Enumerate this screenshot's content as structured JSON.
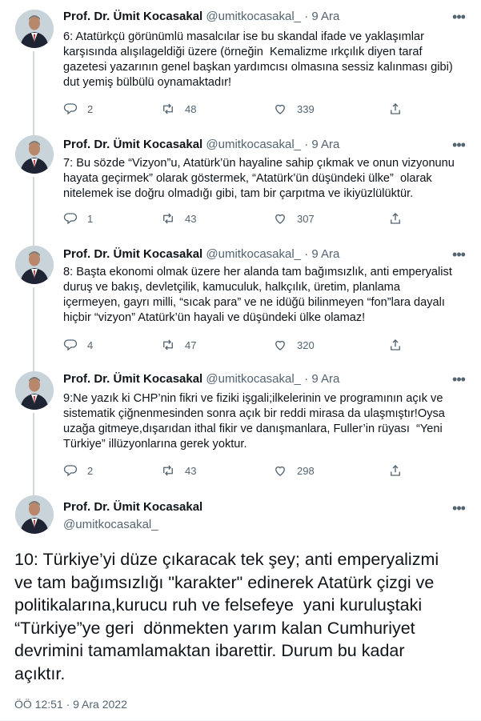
{
  "author": {
    "name": "Prof. Dr. Ümit Kocasakal",
    "handle": "@umitkocasakal_"
  },
  "separator": "·",
  "tweets": [
    {
      "time": "9 Ara",
      "lines": [
        "6: Atatürkçü görünümlü masalcılar ise bu skandal ifade ve yaklaşımlar",
        "karşısında alışılageldiği üzere (örneğin  Kemalizme ırkçılık diyen taraf",
        "gazetesi yazarının genel başkan yardımcısı olmasına sessiz kalınması gibi)",
        "dut yemiş bülbülü oynamaktadır!"
      ],
      "replies": "2",
      "retweets": "48",
      "likes": "339"
    },
    {
      "time": "9 Ara",
      "lines": [
        "7: Bu sözde “Vizyon”u, Atatürk’ün hayaline sahip çıkmak ve onun vizyonunu",
        "hayata geçirmek” olarak göstermek, “Atatürk’ün düşündeki ülke”  olarak",
        "nitelemek ise doğru olmadığı gibi, tam bir çarpıtma ve ikiyüzlülüktür."
      ],
      "replies": "1",
      "retweets": "43",
      "likes": "307"
    },
    {
      "time": "9 Ara",
      "lines": [
        "8: Başta ekonomi olmak üzere her alanda tam bağımsızlık, anti emperyalist",
        "duruş ve bakış, devletçilik, kamuculuk, halkçılık, üretim, planlama",
        "içermeyen, gayrı milli, “sıcak para” ve ne idüğü bilinmeyen “fon”lara dayalı",
        "hiçbir “vizyon” Atatürk’ün hayali ve düşündeki ülke olamaz!"
      ],
      "replies": "4",
      "retweets": "47",
      "likes": "320"
    },
    {
      "time": "9 Ara",
      "lines": [
        "9:Ne yazık ki CHP’nin fikri ve fiziki işgali;ilkelerinin ve programının açık ve",
        "sistematik çiğnenmesinden sonra açık bir reddi mirasa da ulaşmıştır!Oysa",
        "uzağa gitmeye,dışarıdan ithal fikir ve danışmanlara, Fuller’in rüyası  “Yeni",
        "Türkiye” illüzyonlarına gerek yoktur."
      ],
      "replies": "2",
      "retweets": "43",
      "likes": "298"
    }
  ],
  "main_tweet": {
    "lines": [
      "10: Türkiye’yi düze çıkaracak tek şey; anti emperyalizmi",
      "ve tam bağımsızlığı \"karakter\" edinerek Atatürk çizgi ve",
      "politikalarına,kurucu ruh ve felsefeye  yani kuruluştaki",
      "“Türkiye”ye geri  dönmekten yarım kalan Cumhuriyet",
      "devrimini tamamlamaktan ibarettir. Durum bu kadar",
      "açıktır."
    ],
    "timestamp": "ÖÖ 12:51 · 9 Ara 2022"
  },
  "icons": {
    "reply": "reply-icon",
    "retweet": "retweet-icon",
    "like": "like-icon",
    "share": "share-icon",
    "more": "more-icon"
  },
  "colors": {
    "text": "#0f1419",
    "secondary": "#536471",
    "thread_line": "#cfd9de"
  }
}
